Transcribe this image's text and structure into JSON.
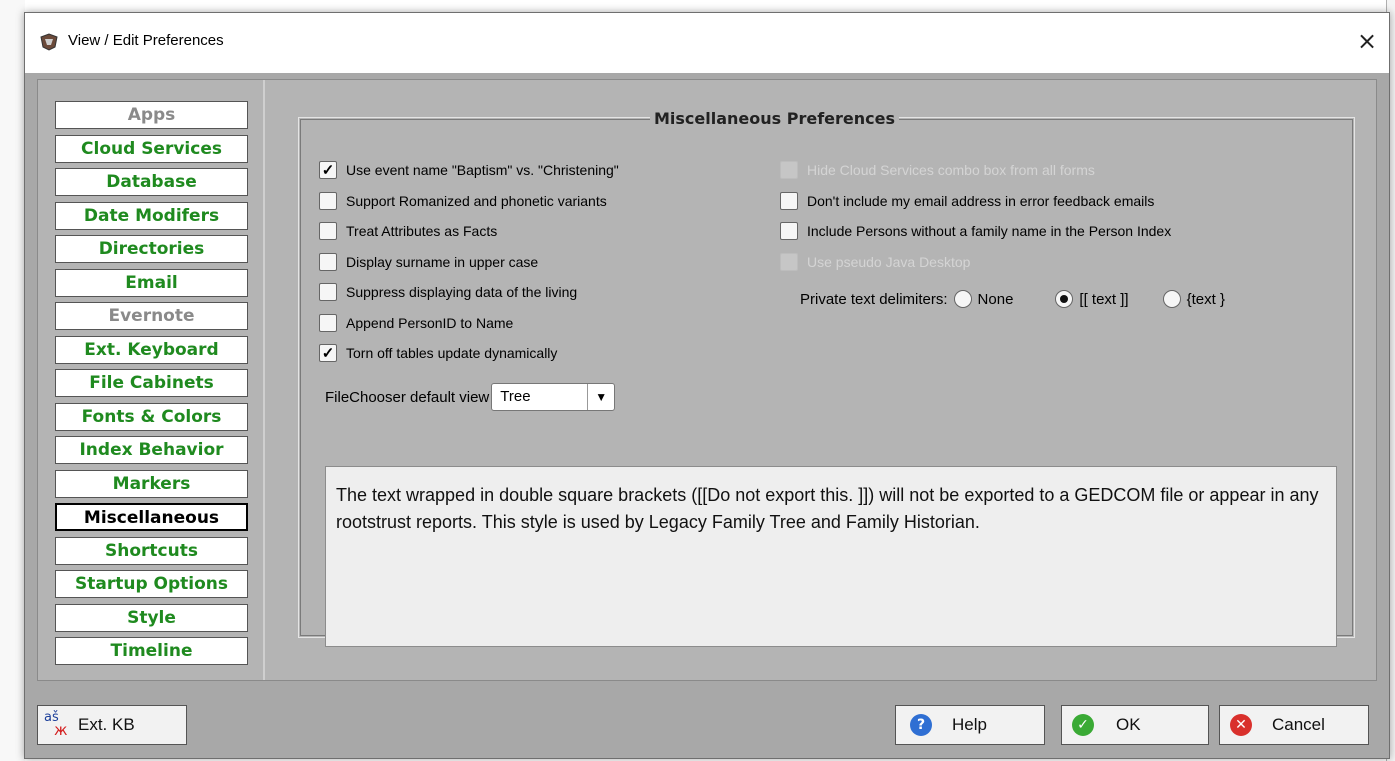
{
  "window": {
    "title": "View / Edit Preferences",
    "close_glyph": "×"
  },
  "sidebar": {
    "items": [
      {
        "label": "Apps",
        "state": "disabled"
      },
      {
        "label": "Cloud Services",
        "state": "normal"
      },
      {
        "label": "Database",
        "state": "normal"
      },
      {
        "label": "Date Modifers",
        "state": "normal"
      },
      {
        "label": "Directories",
        "state": "normal"
      },
      {
        "label": "Email",
        "state": "normal"
      },
      {
        "label": "Evernote",
        "state": "disabled"
      },
      {
        "label": "Ext. Keyboard",
        "state": "normal"
      },
      {
        "label": "File Cabinets",
        "state": "normal"
      },
      {
        "label": "Fonts & Colors",
        "state": "normal"
      },
      {
        "label": "Index Behavior",
        "state": "normal"
      },
      {
        "label": "Markers",
        "state": "normal"
      },
      {
        "label": "Miscellaneous",
        "state": "selected"
      },
      {
        "label": "Shortcuts",
        "state": "normal"
      },
      {
        "label": "Startup Options",
        "state": "normal"
      },
      {
        "label": "Style",
        "state": "normal"
      },
      {
        "label": "Timeline",
        "state": "normal"
      }
    ]
  },
  "misc": {
    "group_title": "Miscellaneous Preferences",
    "left_options": [
      {
        "label": "Use event name \"Baptism\" vs. \"Christening\"",
        "checked": true,
        "enabled": true
      },
      {
        "label": "Support Romanized and phonetic variants",
        "checked": false,
        "enabled": true
      },
      {
        "label": "Treat Attributes as Facts",
        "checked": false,
        "enabled": true
      },
      {
        "label": "Display surname in upper case",
        "checked": false,
        "enabled": true
      },
      {
        "label": "Suppress displaying data of the living",
        "checked": false,
        "enabled": true
      },
      {
        "label": "Append PersonID to Name",
        "checked": false,
        "enabled": true
      },
      {
        "label": "Torn off tables update dynamically",
        "checked": true,
        "enabled": true
      }
    ],
    "right_options": [
      {
        "label": "Hide Cloud Services combo box from all forms",
        "checked": false,
        "enabled": false
      },
      {
        "label": "Don't include my email address in error feedback emails",
        "checked": false,
        "enabled": true
      },
      {
        "label": "Include Persons without a family name in the Person Index",
        "checked": false,
        "enabled": true
      },
      {
        "label": "Use pseudo Java Desktop",
        "checked": false,
        "enabled": false
      }
    ],
    "delimiters": {
      "label": "Private text delimiters:",
      "options": [
        {
          "label": "None",
          "selected": false
        },
        {
          "label": "[[ text ]]",
          "selected": true
        },
        {
          "label": "{text }",
          "selected": false
        }
      ]
    },
    "filechooser": {
      "label": "FileChooser default view",
      "value": "Tree",
      "arrow": "▼"
    },
    "info_text": "The text wrapped in double square brackets ([[Do not export this. ]]) will not be exported to a GEDCOM file or appear in any rootstrust reports. This style is used by Legacy Family Tree and Family Historian."
  },
  "footer": {
    "ext_kb": {
      "label": "Ext. KB",
      "icon": "keyboard-translit-icon",
      "glyph_top": "aš",
      "glyph_bottom": "ж"
    },
    "help": {
      "label": "Help",
      "icon": "question-icon",
      "color": "#2f6fd3"
    },
    "ok": {
      "label": "OK",
      "icon": "check-icon",
      "color": "#3aaa35"
    },
    "cancel": {
      "label": "Cancel",
      "icon": "cancel-x-icon",
      "color": "#d9302c"
    }
  },
  "colors": {
    "enabled_nav": "#1f8a1f",
    "disabled_nav": "#8a8a8a",
    "panel_bg": "#b4b4b4"
  }
}
